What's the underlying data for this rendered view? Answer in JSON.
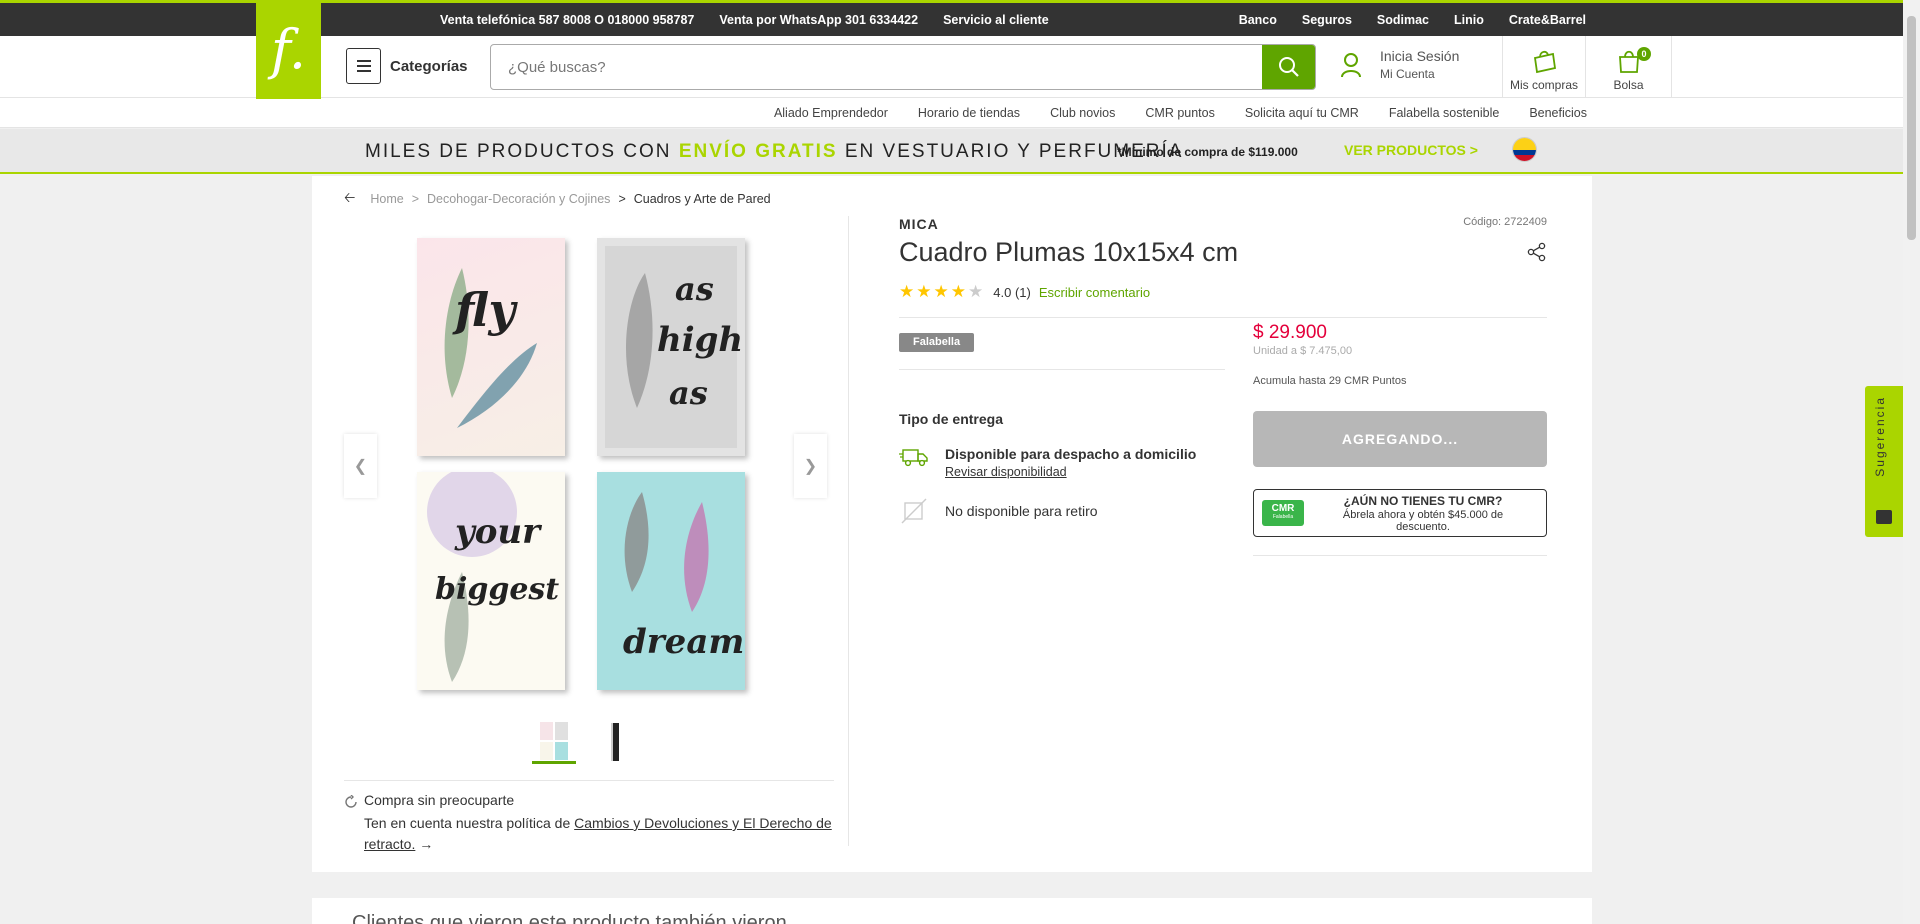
{
  "topbar": {
    "left_links": [
      "Venta telefónica 587 8008 O 018000 958787",
      "Venta por WhatsApp 301 6334422",
      "Servicio al cliente"
    ],
    "right_links": [
      "Banco",
      "Seguros",
      "Sodimac",
      "Linio",
      "Crate&Barrel"
    ]
  },
  "logo": {
    "glyph": "f."
  },
  "header": {
    "categories_label": "Categorías",
    "search_placeholder": "¿Qué buscas?",
    "account_line1": "Inicia Sesión",
    "account_line2": "Mi Cuenta",
    "purchases_label": "Mis compras",
    "bag_label": "Bolsa",
    "bag_count": "0"
  },
  "subnav": {
    "links": [
      "Aliado Emprendedor",
      "Horario de tiendas",
      "Club novios",
      "CMR puntos",
      "Solicita aquí tu CMR",
      "Falabella sostenible",
      "Beneficios"
    ]
  },
  "promo": {
    "part1": "MILES DE PRODUCTOS CON ",
    "highlight": "ENVÍO GRATIS",
    "part2": " EN VESTUARIO Y PERFUMERÍA",
    "minimum": "*Mínimo de compra de $119.000",
    "cta": "VER PRODUCTOS >"
  },
  "breadcrumb": {
    "items": [
      "Home",
      "Decohogar-Decoración y Cojines"
    ],
    "current": "Cuadros y Arte de Pared",
    "separator": ">"
  },
  "gallery": {
    "words": [
      "fly",
      "as",
      "high",
      "as",
      "your",
      "biggest",
      "dream"
    ],
    "prev_icon": "chevron-left-icon",
    "next_icon": "chevron-right-icon"
  },
  "worry": {
    "title": "Compra sin preocuparte",
    "text": "Ten en cuenta nuestra política de ",
    "link": "Cambios y Devoluciones y El Derecho de retracto.",
    "arrow": "→"
  },
  "product": {
    "brand": "MICA",
    "code": "Código: 2722409",
    "title": "Cuadro Plumas 10x15x4 cm",
    "rating": "4.0",
    "rating_value": 4,
    "rating_max": 5,
    "reviews": "(1)",
    "write_review": "Escribir comentario",
    "seller": "Falabella",
    "price": "$ 29.900",
    "unit_price": "Unidad a $ 7.475,00",
    "cmr_points": "Acumula hasta 29 CMR Puntos",
    "add_button": "AGREGANDO..."
  },
  "delivery": {
    "title": "Tipo de entrega",
    "home_title": "Disponible para despacho a domicilio",
    "home_link": "Revisar disponibilidad",
    "pickup": "No disponible para retiro"
  },
  "cmr_promo": {
    "logo": "CMR",
    "logo_sub": "Falabella",
    "title": "¿AÚN NO TIENES TU CMR?",
    "text": "Ábrela ahora y obtén $45.000 de descuento."
  },
  "bottom": {
    "title": "Clientes que vieron este producto también vieron"
  },
  "sugerencia": {
    "label": "Sugerencia"
  },
  "colors": {
    "brand_green": "#aad500",
    "action_green": "#5fa500",
    "price_red": "#e4003b",
    "topbar": "#333333"
  }
}
